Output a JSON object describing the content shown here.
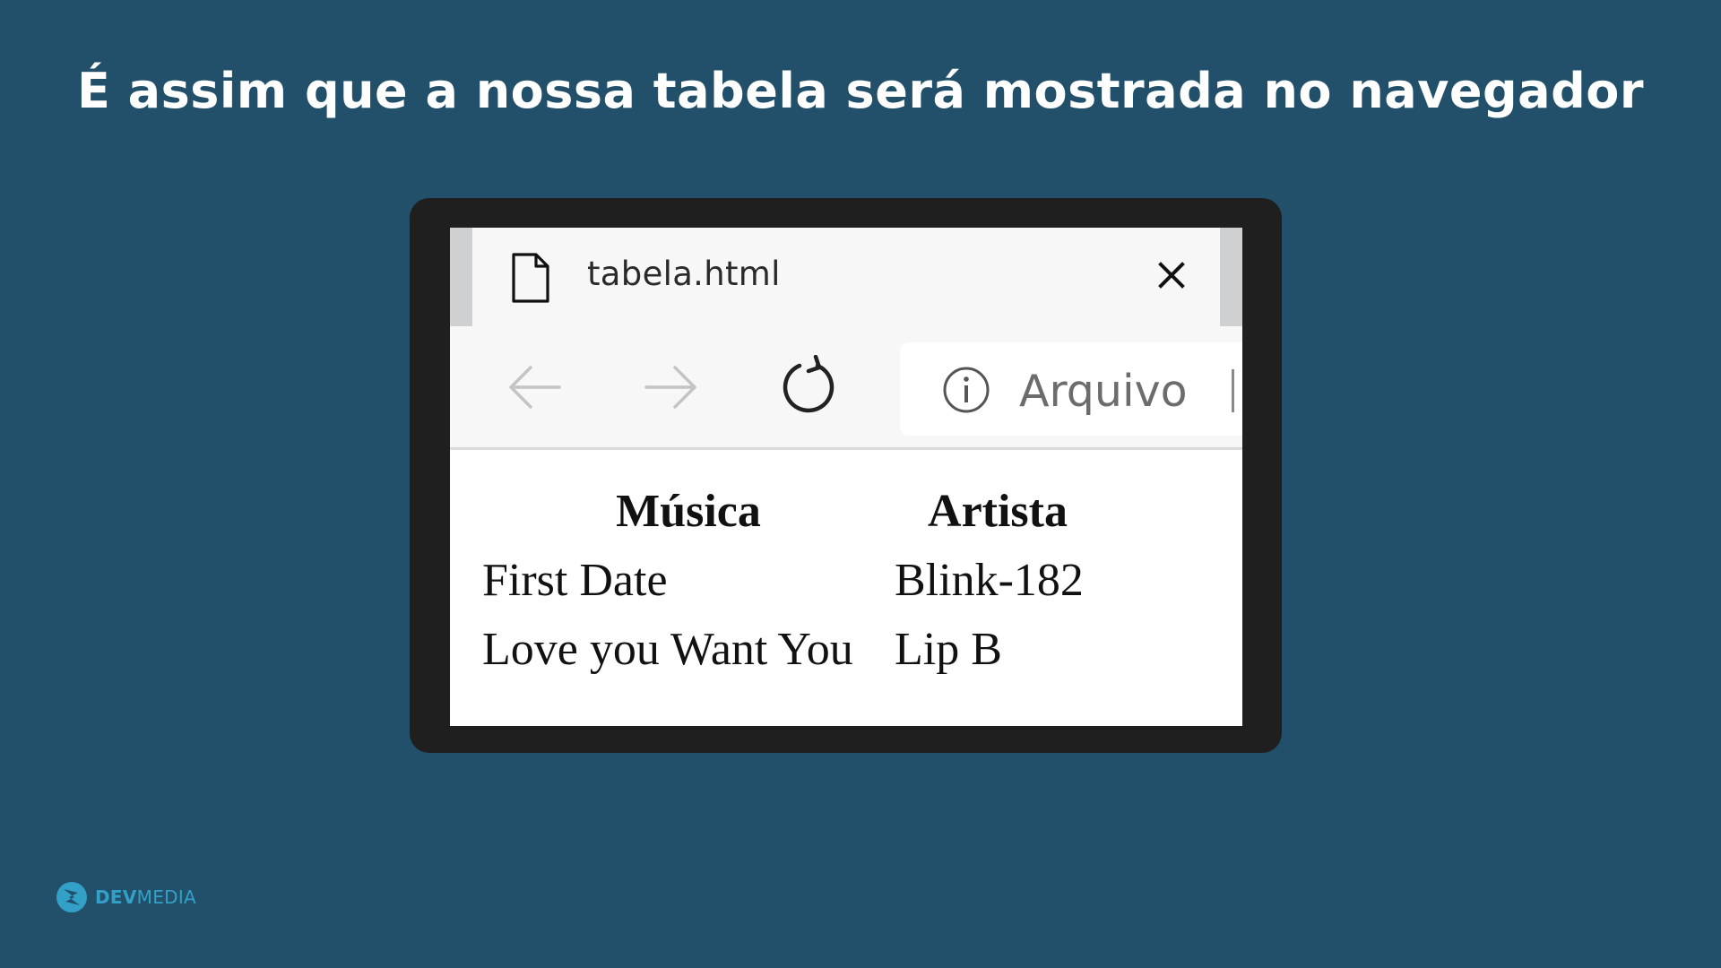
{
  "slide": {
    "title": "É assim que a nossa tabela será mostrada no navegador"
  },
  "browser": {
    "tab": {
      "icon": "file-icon",
      "title": "tabela.html",
      "close_icon": "close-icon"
    },
    "toolbar": {
      "back_icon": "arrow-left-icon",
      "forward_icon": "arrow-right-icon",
      "reload_icon": "reload-icon",
      "info_icon": "info-icon",
      "address_label": "Arquivo"
    }
  },
  "table": {
    "headers": [
      "Música",
      "Artista"
    ],
    "rows": [
      [
        "First Date",
        "Blink-182"
      ],
      [
        "Love you Want You",
        "Lip B"
      ]
    ]
  },
  "logo": {
    "text_bold": "DEV",
    "text_regular": "MEDIA"
  },
  "colors": {
    "background": "#22506a",
    "frame": "#1f1f20",
    "logo_accent": "#33a0c8"
  }
}
